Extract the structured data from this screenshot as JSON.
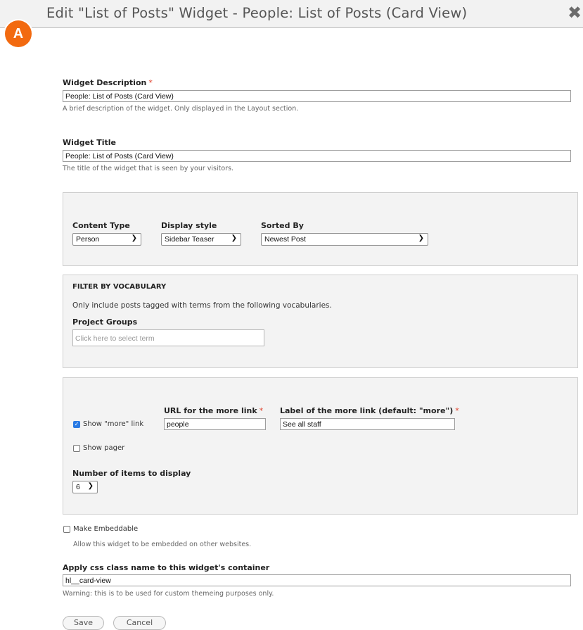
{
  "dialog": {
    "title": "Edit \"List of Posts\" Widget - People: List of Posts (Card View)",
    "close_symbol": "✖",
    "badge_letter": "A",
    "badge_color": "#f26a10"
  },
  "widget_description": {
    "label": "Widget Description",
    "required_mark": "*",
    "value": "People: List of Posts (Card View)",
    "help": "A brief description of the widget. Only displayed in the Layout section."
  },
  "widget_title": {
    "label": "Widget Title",
    "value": "People: List of Posts (Card View)",
    "help": "The title of the widget that is seen by your visitors."
  },
  "content_settings": {
    "content_type": {
      "label": "Content Type",
      "selected": "Person"
    },
    "display_style": {
      "label": "Display style",
      "selected": "Sidebar Teaser"
    },
    "sorted_by": {
      "label": "Sorted By",
      "selected": "Newest Post"
    }
  },
  "filter": {
    "heading": "FILTER BY VOCABULARY",
    "intro": "Only include posts tagged with terms from the following vocabularies.",
    "project_groups_label": "Project Groups",
    "project_groups_placeholder": "Click here to select term"
  },
  "more_link": {
    "show_more_label": "Show \"more\" link",
    "show_more_checked": true,
    "url_label": "URL for the more link",
    "url_value": "people",
    "label_label": "Label of the more link (default: \"more\")",
    "label_value": "See all staff",
    "required_mark": "*",
    "show_pager_label": "Show pager",
    "show_pager_checked": false,
    "num_items_label": "Number of items to display",
    "num_items_value": "6"
  },
  "embeddable": {
    "label": "Make Embeddable",
    "checked": false,
    "help": "Allow this widget to be embedded on other websites."
  },
  "css_class": {
    "label": "Apply css class name to this widget's container",
    "value": "hl__card-view",
    "help": "Warning: this is to be used for custom themeing purposes only."
  },
  "buttons": {
    "save": "Save",
    "cancel": "Cancel"
  },
  "icons": {
    "close": "close-icon",
    "check": "checkmark-icon",
    "chevron": "chevron-down-icon"
  },
  "colors": {
    "accent_checkbox": "#2a7be4",
    "required": "#e0412c"
  }
}
